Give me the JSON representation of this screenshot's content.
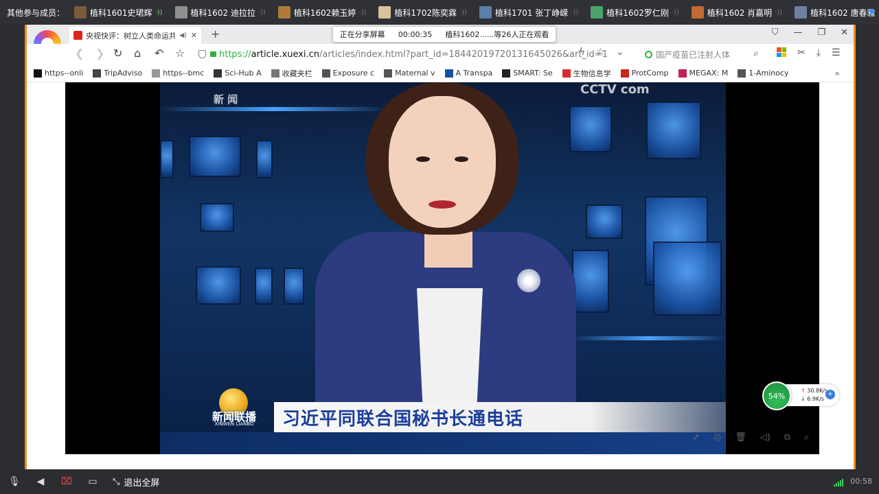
{
  "participants": {
    "label": "其他参与成员：",
    "members": [
      {
        "name": "植科1601史珺辉",
        "speaking": true,
        "color": "#7a5b3a"
      },
      {
        "name": "植科1602  迪拉拉",
        "speaking": false,
        "color": "#8f8f8f"
      },
      {
        "name": "植科1602赖玉婷",
        "speaking": false,
        "color": "#b07a3a"
      },
      {
        "name": "植科1702陈奕霖",
        "speaking": false,
        "color": "#d9c39a"
      },
      {
        "name": "植科1701 张丁峥嵘",
        "speaking": false,
        "color": "#5a7fa8"
      },
      {
        "name": "植科1602罗仁刚",
        "speaking": false,
        "color": "#4aa36a"
      },
      {
        "name": "植科1602 肖嘉明",
        "speaking": false,
        "color": "#c26a2f"
      },
      {
        "name": "植科1602 唐春雅",
        "speaking": false,
        "color": "#6f7fa0"
      }
    ]
  },
  "share": {
    "status": "正在分享屏幕",
    "time": "00:00:35",
    "viewers": "植科1602......等26人正在观看"
  },
  "browser": {
    "tab_title": "央视快评：树立人类命运共",
    "url_scheme": "https://",
    "url_domain": "article.xuexi.cn",
    "url_path": "/articles/index.html?part_id=18442019720131645026&art_id=1",
    "search_placeholder": "国产疫苗已注射人体",
    "bookmarks": [
      {
        "label": "https--onli",
        "color": "#111"
      },
      {
        "label": "TripAdviso",
        "color": "#444"
      },
      {
        "label": "https--bmc",
        "color": "#999"
      },
      {
        "label": "Sci-Hub  A",
        "color": "#333"
      },
      {
        "label": "收藏夹栏",
        "color": "#777"
      },
      {
        "label": "Exposure c",
        "color": "#555"
      },
      {
        "label": "Maternal v",
        "color": "#555"
      },
      {
        "label": "A Transpa",
        "color": "#1d4fa3"
      },
      {
        "label": "SMART: Se",
        "color": "#222"
      },
      {
        "label": "生物信息学",
        "color": "#d62c2c"
      },
      {
        "label": "ProtComp",
        "color": "#c22"
      },
      {
        "label": "MEGAX: M",
        "color": "#c71f5a"
      },
      {
        "label": "1-Aminocy",
        "color": "#555"
      }
    ],
    "bookmarks_more": "»"
  },
  "video": {
    "channel_text": "新 闻",
    "cctv_mark": "CCTV com",
    "program_cn": "新闻联播",
    "program_en": "XINWEN LIANBO",
    "headline": "习近平同联合国秘书长通电话"
  },
  "network": {
    "percent": "54%",
    "up": "30.8K/s",
    "down": "6.9K/s"
  },
  "toolbar": {
    "exit_fullscreen": "退出全屏",
    "clock": "00:58"
  }
}
